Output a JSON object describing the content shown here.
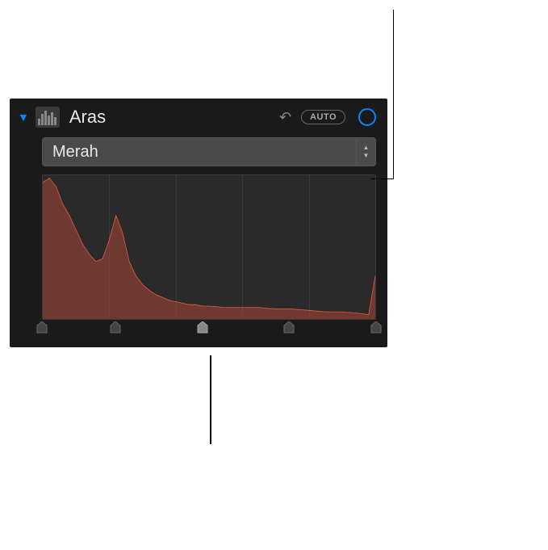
{
  "panel": {
    "title": "Aras",
    "auto_label": "AUTO"
  },
  "dropdown": {
    "selected": "Merah"
  },
  "histogram": {
    "color_stroke": "#e85a3f",
    "color_fill": "rgba(180,70,55,0.5)",
    "grid_positions": [
      20,
      40,
      60,
      80
    ]
  },
  "sliders": {
    "positions": [
      0,
      22,
      48,
      74,
      100
    ],
    "active_index": 2
  },
  "chart_data": {
    "type": "area",
    "title": "",
    "xlabel": "",
    "ylabel": "",
    "x": [
      0,
      2,
      4,
      6,
      8,
      10,
      12,
      14,
      16,
      18,
      20,
      22,
      24,
      26,
      28,
      30,
      32,
      34,
      36,
      38,
      40,
      42,
      44,
      46,
      48,
      50,
      55,
      60,
      65,
      70,
      75,
      80,
      85,
      90,
      95,
      98,
      100
    ],
    "values": [
      95,
      98,
      92,
      80,
      72,
      62,
      52,
      45,
      40,
      42,
      55,
      72,
      60,
      40,
      30,
      24,
      20,
      17,
      15,
      13,
      12,
      11,
      10,
      10,
      9,
      9,
      8,
      8,
      8,
      7,
      7,
      6,
      5,
      5,
      4,
      3,
      30
    ],
    "ylim": [
      0,
      100
    ],
    "series_name": "Merah"
  }
}
